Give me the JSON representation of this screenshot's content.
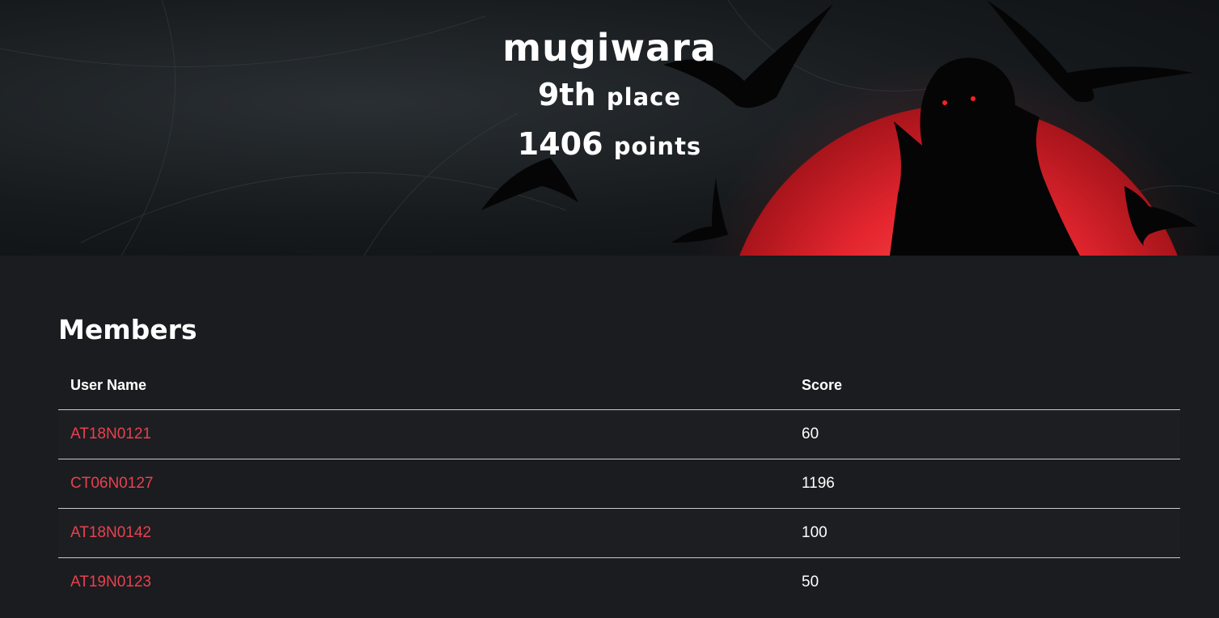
{
  "banner": {
    "team_name": "mugiwara",
    "place_number": "9th",
    "place_label": "place",
    "points_number": "1406",
    "points_label": "points"
  },
  "members": {
    "title": "Members",
    "columns": {
      "user": "User Name",
      "score": "Score"
    },
    "rows": [
      {
        "user": "AT18N0121",
        "score": "60"
      },
      {
        "user": "CT06N0127",
        "score": "1196"
      },
      {
        "user": "AT18N0142",
        "score": "100"
      },
      {
        "user": "AT19N0123",
        "score": "50"
      }
    ]
  },
  "colors": {
    "page_bg": "#1b1c1f",
    "link": "#e8414f",
    "moon_red": "#e0202a"
  }
}
